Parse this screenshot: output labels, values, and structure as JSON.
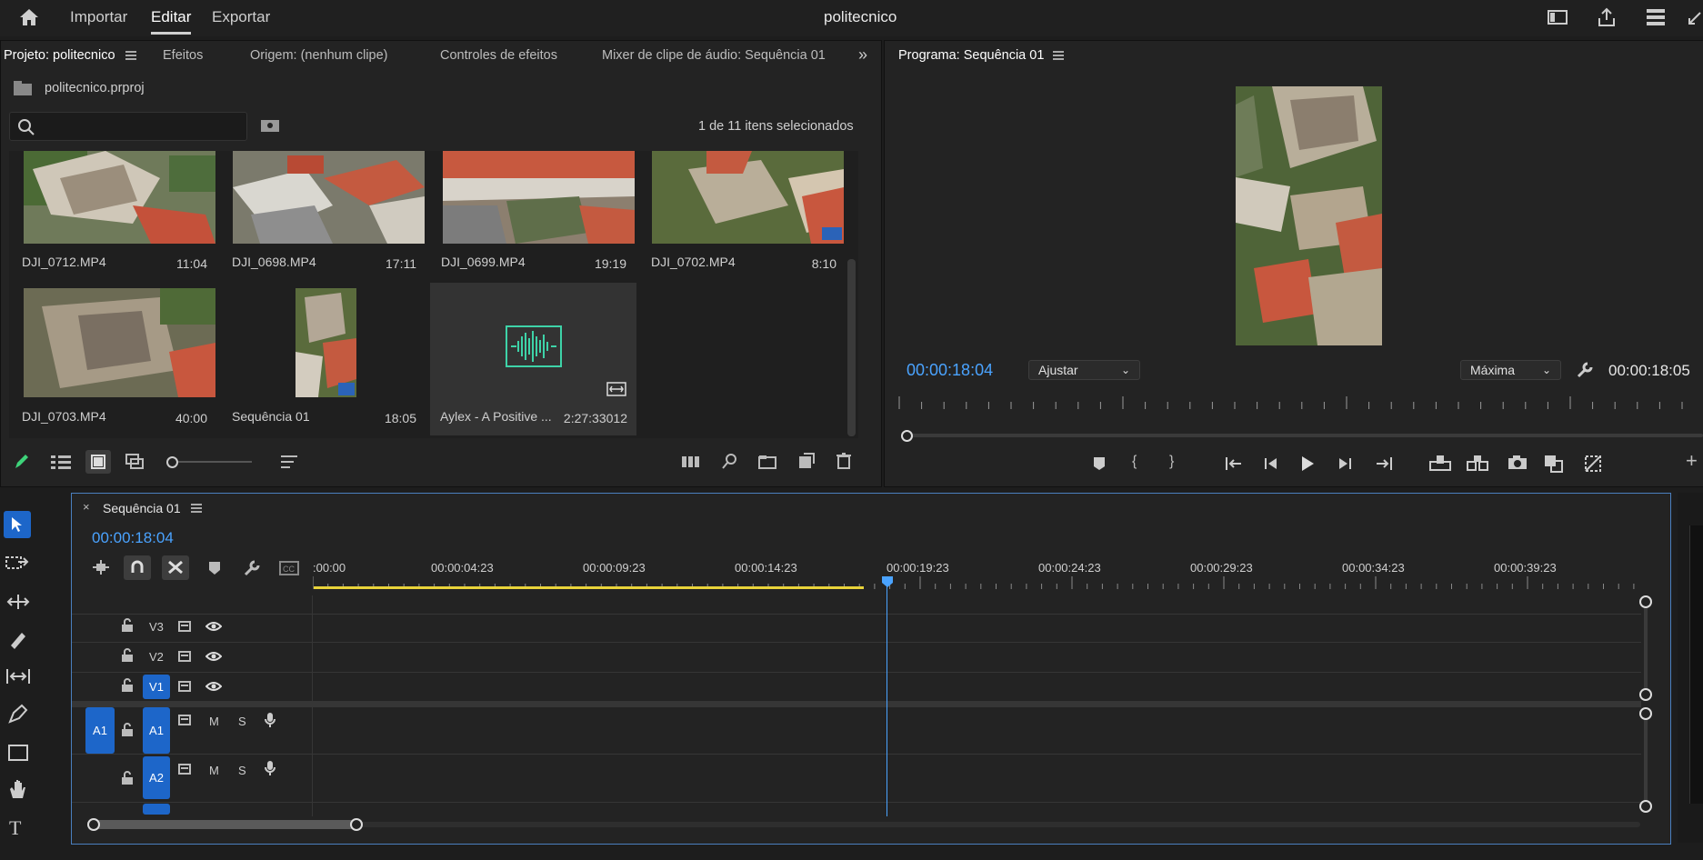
{
  "app": {
    "title": "politecnico"
  },
  "menu": {
    "importar": "Importar",
    "editar": "Editar",
    "exportar": "Exportar"
  },
  "project_panel": {
    "tabs": [
      "Projeto: politecnico",
      "Efeitos",
      "Origem: (nenhum clipe)",
      "Controles de efeitos",
      "Mixer de clipe de áudio: Sequência 01"
    ],
    "project_file": "politecnico.prproj",
    "search_placeholder": "",
    "selection_status": "1 de 11 itens selecionados",
    "clips": [
      {
        "name": "DJI_0712.MP4",
        "duration": "11:04"
      },
      {
        "name": "DJI_0698.MP4",
        "duration": "17:11"
      },
      {
        "name": "DJI_0699.MP4",
        "duration": "19:19"
      },
      {
        "name": "DJI_0702.MP4",
        "duration": "8:10"
      },
      {
        "name": "DJI_0703.MP4",
        "duration": "40:00"
      },
      {
        "name": "Sequência 01",
        "duration": "18:05"
      },
      {
        "name": "Aylex - A Positive ...",
        "duration": "2:27:33012"
      }
    ]
  },
  "program_monitor": {
    "title": "Programa: Sequência 01",
    "current_timecode": "00:00:18:04",
    "zoom_select": "Ajustar",
    "quality_select": "Máxima",
    "duration_timecode": "00:00:18:05"
  },
  "timeline": {
    "tab_title": "Sequência 01",
    "timecode": "00:00:18:04",
    "ruler_labels": [
      ":00:00",
      "00:00:04:23",
      "00:00:09:23",
      "00:00:14:23",
      "00:00:19:23",
      "00:00:24:23",
      "00:00:29:23",
      "00:00:34:23",
      "00:00:39:23"
    ],
    "video_tracks": [
      "V3",
      "V2",
      "V1"
    ],
    "audio_tracks": [
      "A1",
      "A2"
    ],
    "source_patch": "A1",
    "mute_label": "M",
    "solo_label": "S",
    "playhead_fraction": 0.449
  },
  "colors": {
    "accent_blue": "#4aa3ff",
    "track_blue": "#1d66c9",
    "work_area_yellow": "#e8d33a"
  }
}
